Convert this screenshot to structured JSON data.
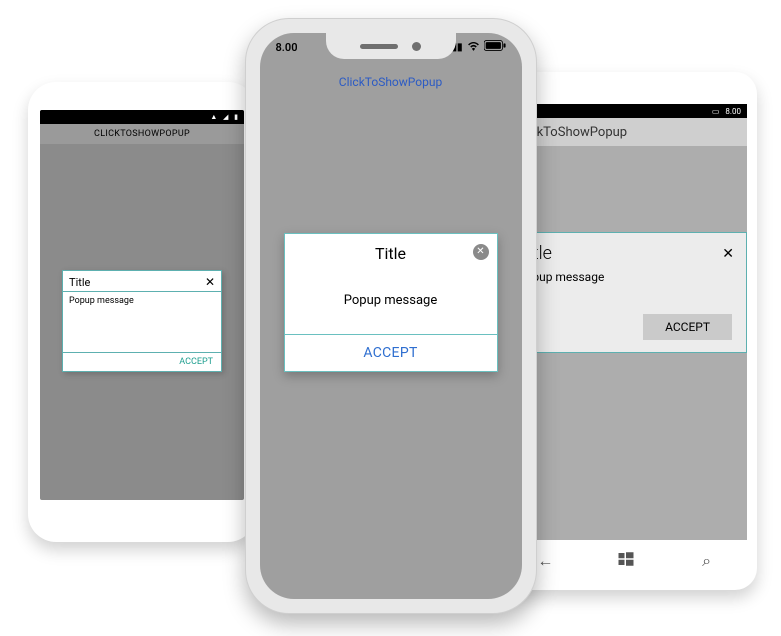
{
  "android": {
    "app_title": "CLICKTOSHOWPOPUP",
    "popup_title": "Title",
    "popup_message": "Popup message",
    "accept_label": "ACCEPT"
  },
  "iphone": {
    "time": "8.00",
    "nav_title": "ClickToShowPopup",
    "popup_title": "Title",
    "popup_message": "Popup message",
    "accept_label": "ACCEPT"
  },
  "windows": {
    "app_title": "ClickToShowPopup",
    "time": "8.00",
    "popup_title": "Title",
    "popup_message": "Popup message",
    "accept_label": "ACCEPT"
  }
}
